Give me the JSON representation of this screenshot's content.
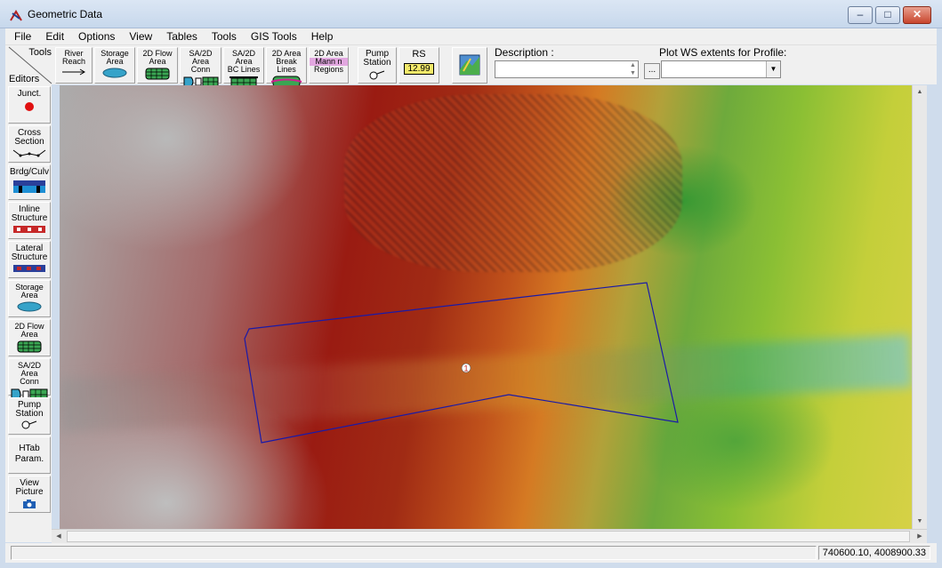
{
  "window": {
    "title": "Geometric Data"
  },
  "menu": [
    "File",
    "Edit",
    "Options",
    "View",
    "Tables",
    "Tools",
    "GIS Tools",
    "Help"
  ],
  "toolbar": {
    "corner_tools": "Tools",
    "corner_editors": "Editors",
    "river_reach": [
      "River",
      "Reach"
    ],
    "storage_area": [
      "Storage",
      "Area"
    ],
    "flow_area_2d": [
      "2D Flow",
      "Area"
    ],
    "sa_2d_conn": [
      "SA/2D Area",
      "Conn"
    ],
    "sa_2d_bc": [
      "SA/2D Area",
      "BC Lines"
    ],
    "area_2d_break": [
      "2D Area",
      "Break Lines"
    ],
    "area_2d_mann": [
      "2D Area",
      "Mann n",
      "Regions"
    ],
    "pump_station": [
      "Pump",
      "Station"
    ],
    "rs_label": "RS",
    "rs_value": "12.99",
    "description_label": "Description :",
    "description_value": "",
    "ellipsis": "...",
    "plot_ws_label": "Plot WS extents for Profile:",
    "plot_ws_value": ""
  },
  "editors": {
    "junct": "Junct.",
    "cross_section": [
      "Cross",
      "Section"
    ],
    "brdg_culv": "Brdg/Culv",
    "inline_structure": [
      "Inline",
      "Structure"
    ],
    "lateral_structure": [
      "Lateral",
      "Structure"
    ],
    "storage_area": [
      "Storage",
      "Area"
    ],
    "flow_area_2d": [
      "2D Flow",
      "Area"
    ],
    "sa_2d_conn": [
      "SA/2D Area",
      "Conn"
    ],
    "pump_station": [
      "Pump",
      "Station"
    ],
    "htab_param": [
      "HTab",
      "Param."
    ],
    "view_picture": [
      "View",
      "Picture"
    ]
  },
  "map": {
    "storage_area_label": "1"
  },
  "status": {
    "coordinates": "740600.10, 4008900.33"
  },
  "colors": {
    "polygon": "#1a1aa8",
    "titlebar": "#c7d8ec"
  }
}
